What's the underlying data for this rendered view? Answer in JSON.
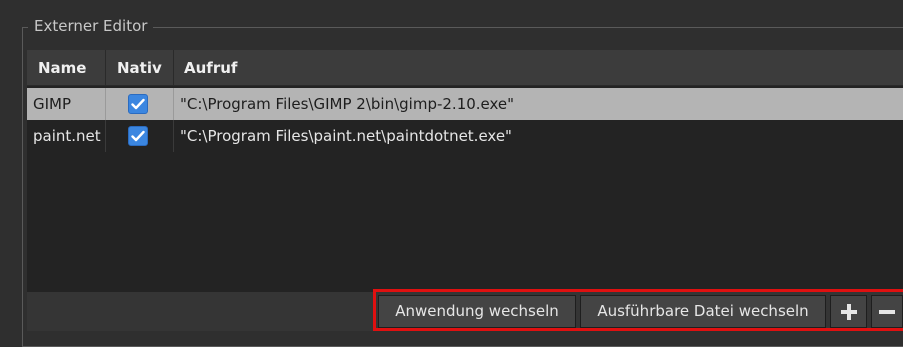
{
  "group": {
    "title": "Externer Editor"
  },
  "table": {
    "columns": [
      "Name",
      "Nativ",
      "Aufruf"
    ],
    "rows": [
      {
        "name": "GIMP",
        "nativ": true,
        "aufruf": "\"C:\\Program Files\\GIMP 2\\bin\\gimp-2.10.exe\"",
        "selected": true
      },
      {
        "name": "paint.net",
        "nativ": true,
        "aufruf": "\"C:\\Program Files\\paint.net\\paintdotnet.exe\"",
        "selected": false
      }
    ]
  },
  "buttons": {
    "change_app": "Anwendung wechseln",
    "change_exe": "Ausführbare Datei wechseln",
    "add_icon": "plus-icon",
    "remove_icon": "minus-icon"
  },
  "colors": {
    "checkbox": "#3b86e0",
    "selection": "#b4b4b4",
    "highlight_frame": "#e01010"
  }
}
